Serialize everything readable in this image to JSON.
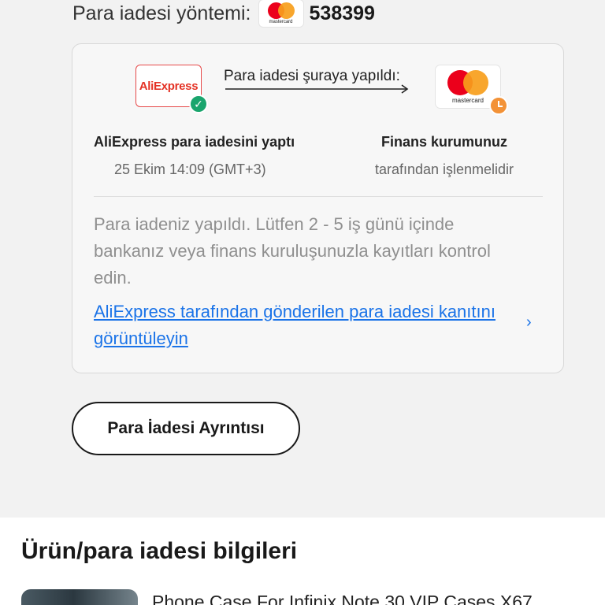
{
  "refund_method": {
    "label": "Para iadesi yöntemi:",
    "card_brand_text": "mastercard",
    "card_number": "538399"
  },
  "flow": {
    "from_logo_text": "AliExpress",
    "label": "Para iadesi şuraya yapıldı:",
    "to_logo_text": "mastercard",
    "left_title": "AliExpress para iadesini yaptı",
    "left_sub": "25 Ekim 14:09 (GMT+3)",
    "right_title": "Finans kurumunuz",
    "right_sub": "tarafından işlenmelidir"
  },
  "note": "Para iadeniz yapıldı. Lütfen 2 - 5 iş günü içinde bankanız veya finans kuruluşunuzla kayıtları kontrol edin.",
  "proof_link": "AliExpress tarafından gönderilen para iadesi kanıtını görüntüleyin",
  "details_button": "Para İadesi Ayrıntısı",
  "section": {
    "title": "Ürün/para iadesi bilgileri",
    "product_title": "Phone Case For Infinix Note 30 VIP Cases X67"
  },
  "colors": {
    "link": "#1a73e8",
    "success": "#1aa56d",
    "pending": "#f39237",
    "aliexpress_red": "#e43225"
  },
  "icons": {
    "check": "check-icon",
    "clock": "clock-icon",
    "chevron": "chevron-right-icon"
  }
}
